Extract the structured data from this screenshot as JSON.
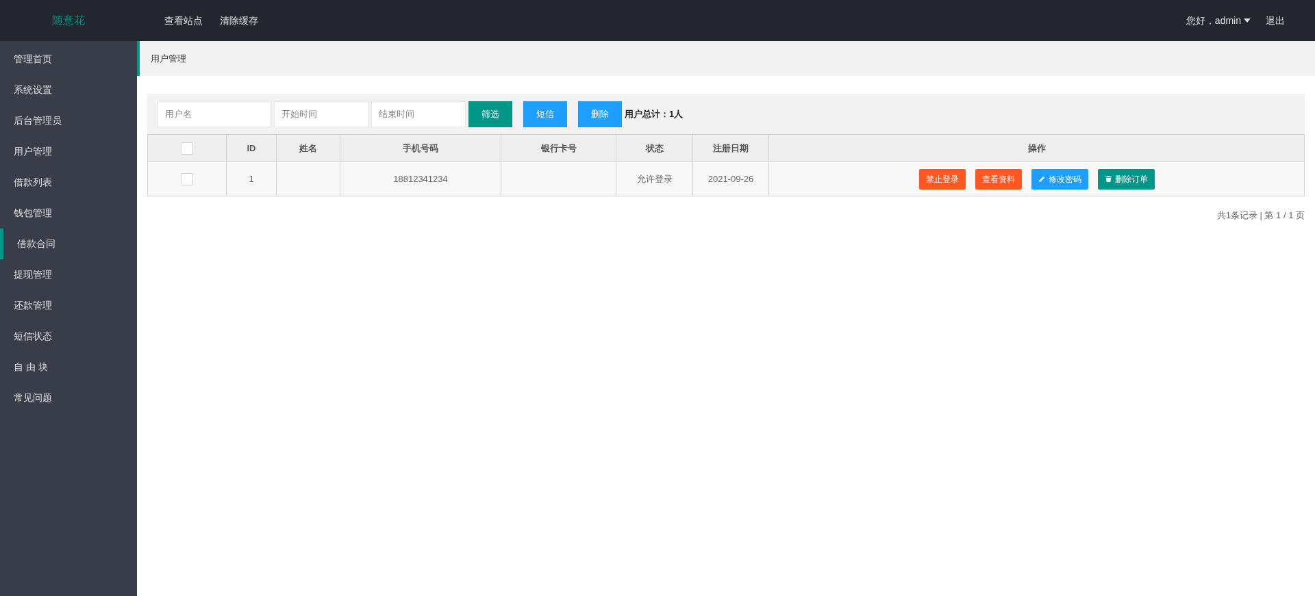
{
  "header": {
    "logo": "随意花",
    "nav": [
      "查看站点",
      "清除缓存"
    ],
    "user": "您好，admin",
    "logout": "退出"
  },
  "sidebar": {
    "items": [
      {
        "label": "管理首页",
        "selected": false
      },
      {
        "label": "系统设置",
        "selected": false
      },
      {
        "label": "后台管理员",
        "selected": false
      },
      {
        "label": "用户管理",
        "selected": false
      },
      {
        "label": "借款列表",
        "selected": false
      },
      {
        "label": "钱包管理",
        "selected": false
      },
      {
        "label": "借款合同",
        "selected": true
      },
      {
        "label": "提现管理",
        "selected": false
      },
      {
        "label": "还款管理",
        "selected": false
      },
      {
        "label": "短信状态",
        "selected": false
      },
      {
        "label": "自 由 块",
        "selected": false
      },
      {
        "label": "常见问题",
        "selected": false
      }
    ]
  },
  "breadcrumb": "用户管理",
  "filter": {
    "fields": [
      {
        "placeholder": "用户名"
      },
      {
        "placeholder": "开始时间"
      },
      {
        "placeholder": "结束时间"
      }
    ],
    "buttons": [
      {
        "label": "筛选",
        "kind": "primary"
      },
      {
        "label": "短信",
        "kind": "normal"
      },
      {
        "label": "删除",
        "kind": "normal"
      }
    ],
    "total": "用户总计：1人"
  },
  "table": {
    "select_all_checked": false,
    "columns": [
      "ID",
      "姓名",
      "手机号码",
      "银行卡号",
      "状态",
      "注册日期",
      "操作"
    ],
    "rows": [
      {
        "checked": false,
        "cells": [
          "1",
          "",
          "18812341234",
          "",
          "允许登录",
          "2021-09-26"
        ],
        "actions": [
          {
            "label": "禁止登录",
            "kind": "danger"
          },
          {
            "label": "查看资料",
            "kind": "danger"
          },
          {
            "label": "修改密码",
            "kind": "edit"
          },
          {
            "label": "删除订单",
            "kind": "delete"
          }
        ]
      }
    ]
  },
  "pagination": "共1条记录 | 第 1 / 1 页"
}
